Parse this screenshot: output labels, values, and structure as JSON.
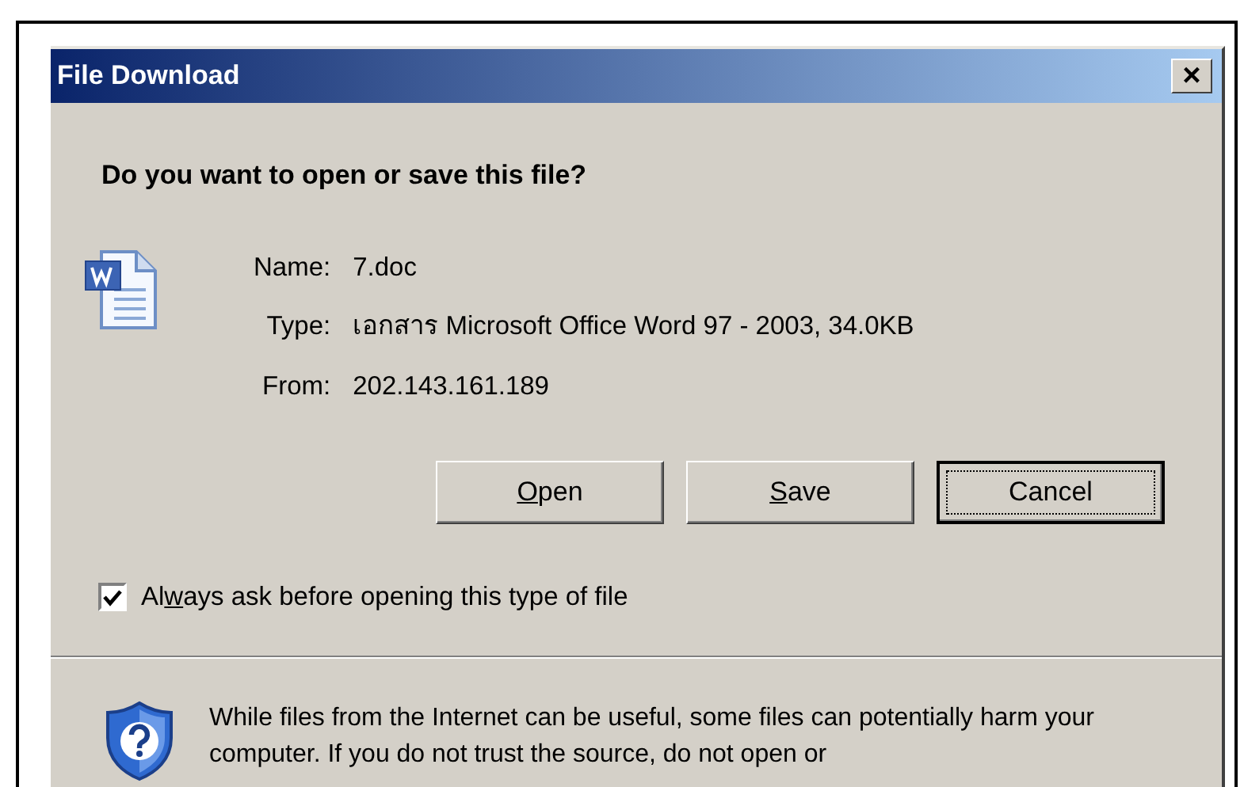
{
  "window": {
    "title": "File Download",
    "close_glyph": "×"
  },
  "heading": "Do you want to open or save this file?",
  "fields": [
    {
      "label": "Name:",
      "value": "7.doc"
    },
    {
      "label": "Type:",
      "value": "เอกสาร Microsoft Office Word 97 - 2003, 34.0KB"
    },
    {
      "label": "From:",
      "value": "202.143.161.189"
    }
  ],
  "buttons": [
    {
      "access_key": "O",
      "label_after": "pen",
      "default": false
    },
    {
      "access_key": "S",
      "label_after": "ave",
      "default": false
    },
    {
      "label_before": "Cancel",
      "default": true
    }
  ],
  "checkbox": {
    "label_before": "Al",
    "access_key": "w",
    "label_after": "ays ask before opening this type of file",
    "checked": true
  },
  "warning": {
    "text": "While files from the Internet can be useful, some files can potentially harm your computer. If you do not trust the source, do not open or"
  }
}
